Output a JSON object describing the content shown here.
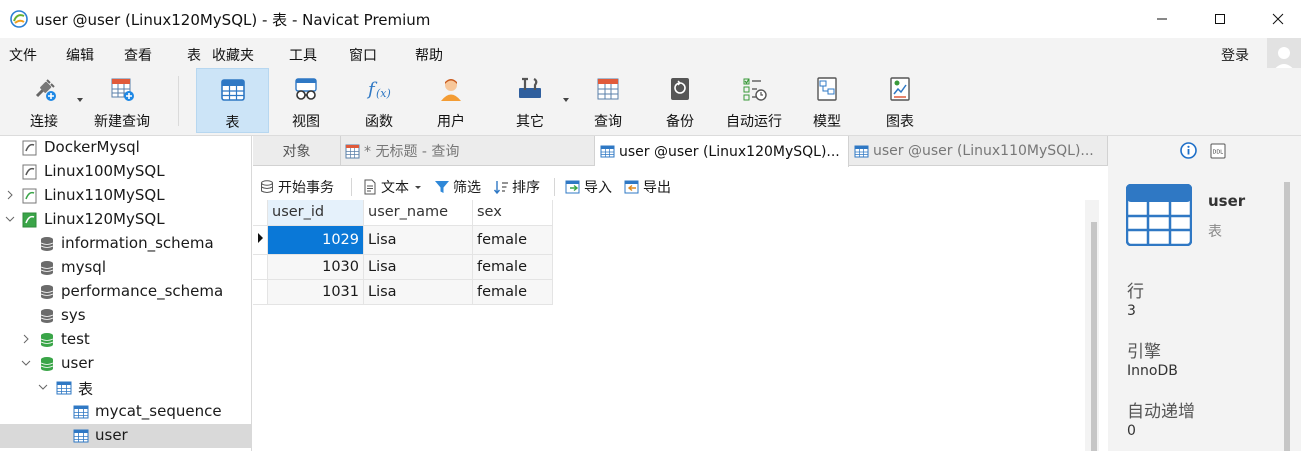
{
  "window": {
    "title": "user @user (Linux120MySQL) - 表 - Navicat Premium",
    "colors": {
      "accent": "#0a78d7",
      "active_tool": "#cce4f7",
      "chrome": "#f3f3f3"
    }
  },
  "menu": {
    "items": [
      "文件",
      "编辑",
      "查看",
      "表",
      "收藏夹",
      "工具",
      "窗口",
      "帮助"
    ],
    "login": "登录"
  },
  "toolbar": {
    "buttons": [
      {
        "label": "连接",
        "icon": "plug-icon"
      },
      {
        "label": "新建查询",
        "icon": "new-query-icon"
      },
      {
        "label": "表",
        "icon": "table-icon"
      },
      {
        "label": "视图",
        "icon": "view-icon"
      },
      {
        "label": "函数",
        "icon": "function-icon"
      },
      {
        "label": "用户",
        "icon": "user-icon"
      },
      {
        "label": "其它",
        "icon": "tools-icon"
      },
      {
        "label": "查询",
        "icon": "query-icon"
      },
      {
        "label": "备份",
        "icon": "backup-icon"
      },
      {
        "label": "自动运行",
        "icon": "automation-icon"
      },
      {
        "label": "模型",
        "icon": "model-icon"
      },
      {
        "label": "图表",
        "icon": "chart-icon"
      }
    ],
    "active": "表"
  },
  "sidebar": {
    "items": [
      {
        "label": "DockerMysql",
        "icon": "connection-icon"
      },
      {
        "label": "Linux100MySQL",
        "icon": "connection-icon"
      },
      {
        "label": "Linux110MySQL",
        "icon": "connection-icon"
      },
      {
        "label": "Linux120MySQL",
        "icon": "connection-open-icon"
      },
      {
        "label": "information_schema",
        "icon": "database-icon"
      },
      {
        "label": "mysql",
        "icon": "database-icon"
      },
      {
        "label": "performance_schema",
        "icon": "database-icon"
      },
      {
        "label": "sys",
        "icon": "database-icon"
      },
      {
        "label": "test",
        "icon": "database-open-icon"
      },
      {
        "label": "user",
        "icon": "database-open-icon"
      },
      {
        "label": "表",
        "icon": "tables-folder-icon"
      },
      {
        "label": "mycat_sequence",
        "icon": "table-icon"
      },
      {
        "label": "user",
        "icon": "table-icon"
      }
    ],
    "selected": "user"
  },
  "tabs": [
    {
      "label": "对象"
    },
    {
      "label": "* 无标题 - 查询"
    },
    {
      "label": "user @user (Linux120MySQL)..."
    },
    {
      "label": "user @user (Linux110MySQL)..."
    }
  ],
  "subtoolbar": {
    "begin_transaction": "开始事务",
    "text": "文本",
    "filter": "筛选",
    "sort": "排序",
    "import": "导入",
    "export": "导出"
  },
  "grid": {
    "columns": [
      "user_id",
      "user_name",
      "sex"
    ],
    "rows": [
      [
        "1029",
        "Lisa",
        "female"
      ],
      [
        "1030",
        "Lisa",
        "female"
      ],
      [
        "1031",
        "Lisa",
        "female"
      ]
    ]
  },
  "info_panel": {
    "name": "user",
    "type": "表",
    "rows_label": "行",
    "rows_value": "3",
    "engine_label": "引擎",
    "engine_value": "InnoDB",
    "autoinc_label": "自动递增",
    "autoinc_value": "0"
  }
}
